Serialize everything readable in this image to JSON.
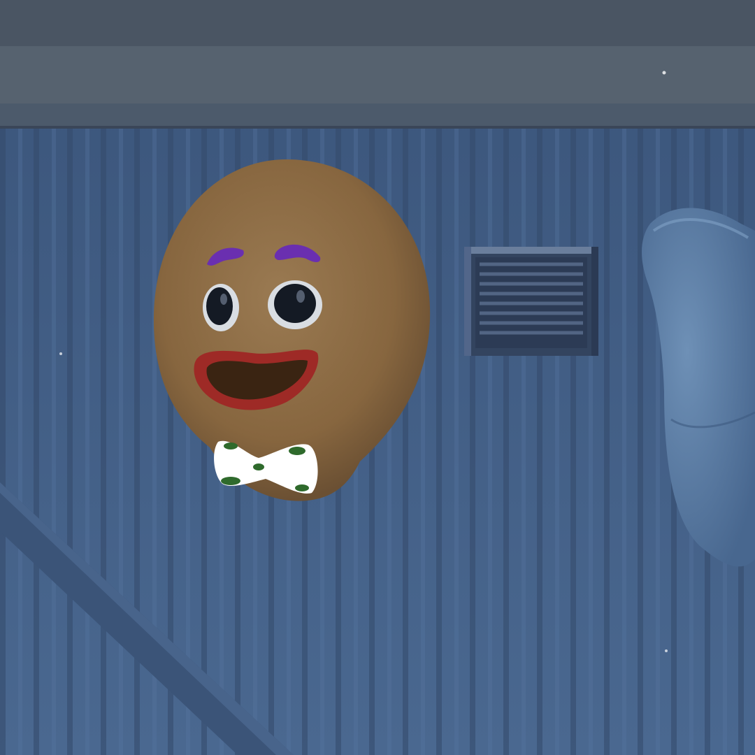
{
  "scene": {
    "description_free": true,
    "colors": {
      "wall_base": "#3f5a80",
      "wall_rib_dark": "#33496a",
      "wall_rib_light": "#4a6791",
      "beam": "#55616f",
      "beam_top": "#4a5563",
      "cookie": "#8a6a45",
      "cookie_shadow": "#6b5033",
      "eyebrow": "#6a2fb0",
      "eye_ring": "#d9dde2",
      "pupil": "#141a24",
      "lips": "#9e2a26",
      "mouth_inside": "#3a2412",
      "bowtie": "#ffffff",
      "bowtie_spots": "#2f6a2c",
      "vent_frame": "#3b4d6c",
      "duct": "#5d7ea4"
    },
    "objects": [
      "gingerbread-head",
      "wall-vent",
      "ventilation-duct",
      "ceiling-beam",
      "diagonal-pipe"
    ]
  }
}
